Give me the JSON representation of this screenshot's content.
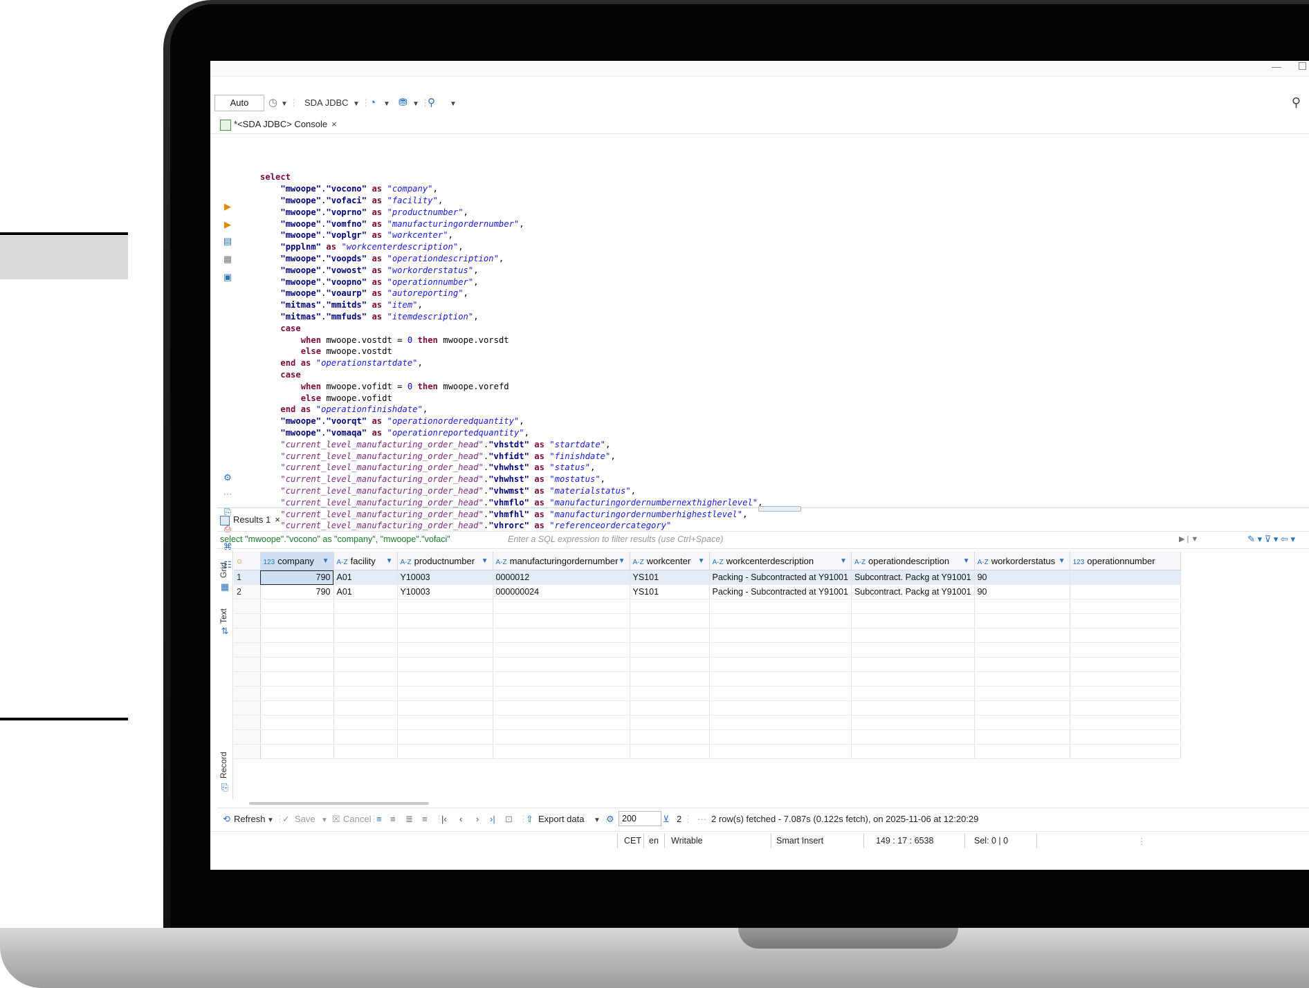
{
  "window": {
    "minimize": "—"
  },
  "toolbar": {
    "mode": "Auto",
    "connection": "SDA JDBC",
    "search_icon": "magnifier-icon"
  },
  "console_tab": {
    "label": "*<SDA JDBC> Console",
    "close": "×"
  },
  "sql_lines": [
    "select",
    "    \"mwoope\".\"vocono\" as \"company\",",
    "    \"mwoope\".\"vofaci\" as \"facility\",",
    "    \"mwoope\".\"voprno\" as \"productnumber\",",
    "    \"mwoope\".\"vomfno\" as \"manufacturingordernumber\",",
    "    \"mwoope\".\"voplgr\" as \"workcenter\",",
    "    \"ppplnm\" as \"workcenterdescription\",",
    "    \"mwoope\".\"voopds\" as \"operationdescription\",",
    "    \"mwoope\".\"vowost\" as \"workorderstatus\",",
    "    \"mwoope\".\"voopno\" as \"operationnumber\",",
    "    \"mwoope\".\"voaurp\" as \"autoreporting\",",
    "    \"mitmas\".\"mmitds\" as \"item\",",
    "    \"mitmas\".\"mmfuds\" as \"itemdescription\",",
    "    case",
    "        when mwoope.vostdt = 0 then mwoope.vorsdt",
    "        else mwoope.vostdt",
    "    end as \"operationstartdate\",",
    "    case",
    "        when mwoope.vofidt = 0 then mwoope.vorefd",
    "        else mwoope.vofidt",
    "    end as \"operationfinishdate\",",
    "    \"mwoope\".\"voorqt\" as \"operationorderedquantity\",",
    "    \"mwoope\".\"vomaqa\" as \"operationreportedquantity\",",
    "    \"current_level_manufacturing_order_head\".\"vhstdt\" as \"startdate\",",
    "    \"current_level_manufacturing_order_head\".\"vhfidt\" as \"finishdate\",",
    "    \"current_level_manufacturing_order_head\".\"vhwhst\" as \"status\",",
    "    \"current_level_manufacturing_order_head\".\"vhwhst\" as \"mostatus\",",
    "    \"current_level_manufacturing_order_head\".\"vhwmst\" as \"materialstatus\",",
    "    \"current_level_manufacturing_order_head\".\"vhmflo\" as \"manufacturingordernumbernexthigherlevel\",",
    "    \"current_level_manufacturing_order_head\".\"vhmfhl\" as \"manufacturingordernumberhighestlevel\",",
    "    \"current_level_manufacturing_order_head\".\"vhrorc\" as \"referenceordercategory\""
  ],
  "results_tab": {
    "label": "Results 1",
    "close": "×"
  },
  "filter": {
    "query": "select \"mwoope\".\"vocono\" as \"company\", \"mwoope\".\"vofaci\"",
    "placeholder": "Enter a SQL expression to filter results (use Ctrl+Space)"
  },
  "side_tabs": {
    "grid": "Grid",
    "text": "Text",
    "record": "Record"
  },
  "columns": [
    {
      "type": "123",
      "name": "company"
    },
    {
      "type": "A-Z",
      "name": "facility"
    },
    {
      "type": "A-Z",
      "name": "productnumber"
    },
    {
      "type": "A-Z",
      "name": "manufacturingordernumber"
    },
    {
      "type": "A-Z",
      "name": "workcenter"
    },
    {
      "type": "A-Z",
      "name": "workcenterdescription"
    },
    {
      "type": "A-Z",
      "name": "operationdescription"
    },
    {
      "type": "A-Z",
      "name": "workorderstatus"
    },
    {
      "type": "123",
      "name": "operationnumber"
    }
  ],
  "rows": [
    {
      "n": "1",
      "cells": [
        "790",
        "A01",
        "Y10003",
        "0000012",
        "YS101",
        "Packing - Subcontracted at Y91001",
        "Subcontract. Packg at Y91001",
        "90",
        ""
      ]
    },
    {
      "n": "2",
      "cells": [
        "790",
        "A01",
        "Y10003",
        "000000024",
        "YS101",
        "Packing - Subcontracted at Y91001",
        "Subcontract. Packg at Y91001",
        "90",
        ""
      ]
    }
  ],
  "bottombar": {
    "refresh": "Refresh",
    "save": "Save",
    "cancel": "Cancel",
    "export": "Export data",
    "fetch_size": "200",
    "row_count": "2",
    "status": "2 row(s) fetched - 7.087s (0.122s fetch), on 2025-11-06 at 12:20:29"
  },
  "statusbar": {
    "timezone": "CET",
    "locale": "en",
    "mode": "Writable",
    "insert": "Smart Insert",
    "position": "149 : 17 : 6538",
    "selection": "Sel: 0 | 0"
  }
}
